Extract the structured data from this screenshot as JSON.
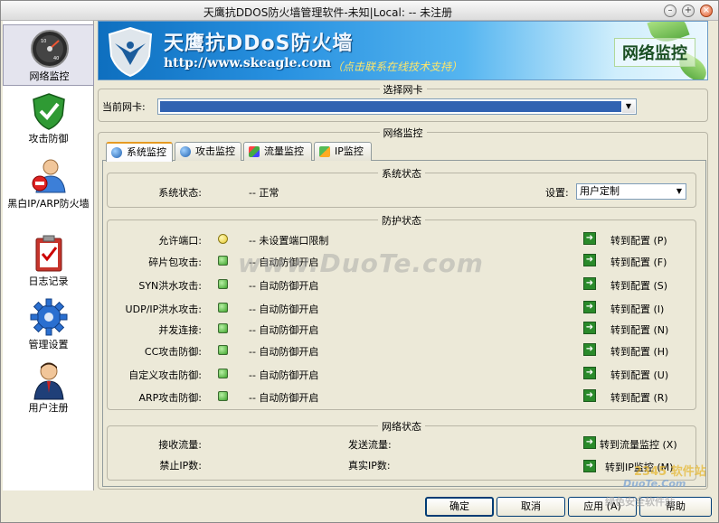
{
  "window": {
    "title": "天鹰抗DDOS防火墙管理软件-未知|Local: -- 未注册"
  },
  "sidebar": {
    "items": [
      {
        "label": "网络监控",
        "icon": "gauge-icon"
      },
      {
        "label": "攻击防御",
        "icon": "shield-check-icon"
      },
      {
        "label": "黑白IP/ARP防火墙",
        "icon": "user-forbidden-icon"
      },
      {
        "label": "日志记录",
        "icon": "clipboard-check-icon"
      },
      {
        "label": "管理设置",
        "icon": "gear-icon"
      },
      {
        "label": "用户注册",
        "icon": "user-tie-icon"
      }
    ]
  },
  "banner": {
    "title": "天鹰抗DDoS防火墙",
    "url": "http://www.skeagle.com",
    "contact": "（点击联系在线技术支持）",
    "section": "网络监控"
  },
  "nic": {
    "group_title": "选择网卡",
    "label": "当前网卡:",
    "value": ""
  },
  "monitor": {
    "group_title": "网络监控",
    "tabs": [
      {
        "label": "系统监控",
        "icon": "globe-icon",
        "active": true
      },
      {
        "label": "攻击监控",
        "icon": "globe-icon",
        "active": false
      },
      {
        "label": "流量监控",
        "icon": "chart-icon",
        "active": false
      },
      {
        "label": "IP监控",
        "icon": "network-icon",
        "active": false
      }
    ]
  },
  "system_status": {
    "group_title": "系统状态",
    "label": "系统状态:",
    "value": "-- 正常",
    "setting_label": "设置:",
    "setting_value": "用户定制"
  },
  "protection": {
    "group_title": "防护状态",
    "rows": [
      {
        "label": "允许端口:",
        "status": "-- 未设置端口限制",
        "led": "yellow",
        "link": "转到配置 (P)"
      },
      {
        "label": "碎片包攻击:",
        "status": "-- 自动防御开启",
        "led": "green",
        "link": "转到配置 (F)"
      },
      {
        "label": "SYN洪水攻击:",
        "status": "-- 自动防御开启",
        "led": "green",
        "link": "转到配置 (S)"
      },
      {
        "label": "UDP/IP洪水攻击:",
        "status": "-- 自动防御开启",
        "led": "green",
        "link": "转到配置 (I)"
      },
      {
        "label": "并发连接:",
        "status": "-- 自动防御开启",
        "led": "green",
        "link": "转到配置 (N)"
      },
      {
        "label": "CC攻击防御:",
        "status": "-- 自动防御开启",
        "led": "green",
        "link": "转到配置 (H)"
      },
      {
        "label": "自定义攻击防御:",
        "status": "-- 自动防御开启",
        "led": "green",
        "link": "转到配置 (U)"
      },
      {
        "label": "ARP攻击防御:",
        "status": "-- 自动防御开启",
        "led": "green",
        "link": "转到配置 (R)"
      }
    ]
  },
  "network_status": {
    "group_title": "网络状态",
    "recv_label": "接收流量:",
    "send_label": "发送流量:",
    "blocked_label": "禁止IP数:",
    "real_label": "真实IP数:",
    "traffic_link": "转到流量监控 (X)",
    "ip_link": "转到IP监控 (M)"
  },
  "buttons": {
    "ok": "确定",
    "cancel": "取消",
    "apply": "应用 (A)",
    "help": "帮助"
  },
  "watermarks": {
    "main": "www.DuoTe.com",
    "corner_1": "2345 软件站",
    "corner_2": "DuoTe.Com",
    "corner_3": "绿色安全软件站"
  }
}
